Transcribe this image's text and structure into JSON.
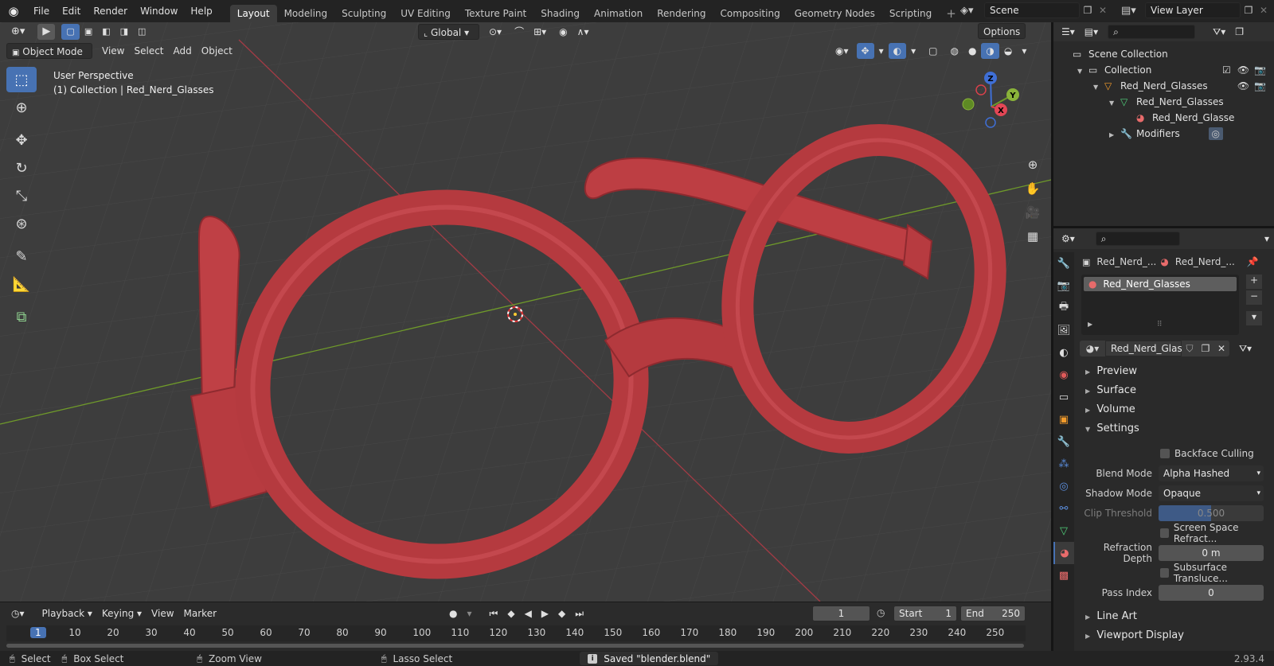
{
  "topbar": {
    "menus": [
      "File",
      "Edit",
      "Render",
      "Window",
      "Help"
    ],
    "tabs": [
      "Layout",
      "Modeling",
      "Sculpting",
      "UV Editing",
      "Texture Paint",
      "Shading",
      "Animation",
      "Rendering",
      "Compositing",
      "Geometry Nodes",
      "Scripting"
    ],
    "active_tab": "Layout",
    "add_tab": "+",
    "scene": "Scene",
    "view_layer": "View Layer"
  },
  "viewport": {
    "mode": "Object Mode",
    "menus": [
      "View",
      "Select",
      "Add",
      "Object"
    ],
    "orientation": "Global",
    "options": "Options",
    "info_line1": "User Perspective",
    "info_line2": "(1) Collection | Red_Nerd_Glasses",
    "gizmo": {
      "x": "X",
      "y": "Y",
      "z": "Z"
    }
  },
  "outliner": {
    "rows": [
      {
        "label": "Scene Collection",
        "indent": 0
      },
      {
        "label": "Collection",
        "indent": 1
      },
      {
        "label": "Red_Nerd_Glasses",
        "indent": 2
      },
      {
        "label": "Red_Nerd_Glasses",
        "indent": 3
      },
      {
        "label": "Red_Nerd_Glasse",
        "indent": 4
      },
      {
        "label": "Modifiers",
        "indent": 3
      }
    ]
  },
  "properties": {
    "breadcrumb_object": "Red_Nerd_...",
    "breadcrumb_material": "Red_Nerd_...",
    "slot": "Red_Nerd_Glasses",
    "material_name": "Red_Nerd_Glass...",
    "panels": {
      "preview": "Preview",
      "surface": "Surface",
      "volume": "Volume",
      "settings": "Settings",
      "line_art": "Line Art",
      "viewport_display": "Viewport Display"
    },
    "settings": {
      "backface_culling": "Backface Culling",
      "blend_mode_label": "Blend Mode",
      "blend_mode": "Alpha Hashed",
      "shadow_mode_label": "Shadow Mode",
      "shadow_mode": "Opaque",
      "clip_threshold_label": "Clip Threshold",
      "clip_threshold": "0.500",
      "ssr": "Screen Space Refract...",
      "refraction_depth_label": "Refraction Depth",
      "refraction_depth": "0 m",
      "subsurface": "Subsurface Transluce...",
      "pass_index_label": "Pass Index",
      "pass_index": "0"
    }
  },
  "timeline": {
    "menus": [
      "Playback",
      "Keying",
      "View",
      "Marker"
    ],
    "current_frame": "1",
    "start_label": "Start",
    "start": "1",
    "end_label": "End",
    "end": "250",
    "ticks": [
      "1",
      "10",
      "20",
      "30",
      "40",
      "50",
      "60",
      "70",
      "80",
      "90",
      "100",
      "110",
      "120",
      "130",
      "140",
      "150",
      "160",
      "170",
      "180",
      "190",
      "200",
      "210",
      "220",
      "230",
      "240",
      "250"
    ]
  },
  "statusbar": {
    "select": "Select",
    "box_select": "Box Select",
    "zoom_view": "Zoom View",
    "lasso_select": "Lasso Select",
    "message": "Saved \"blender.blend\"",
    "version": "2.93.4"
  },
  "colors": {
    "accent": "#4772b3",
    "glasses": "#b83a3e",
    "x_axis": "#a33b45",
    "y_axis": "#6f9a2a"
  }
}
